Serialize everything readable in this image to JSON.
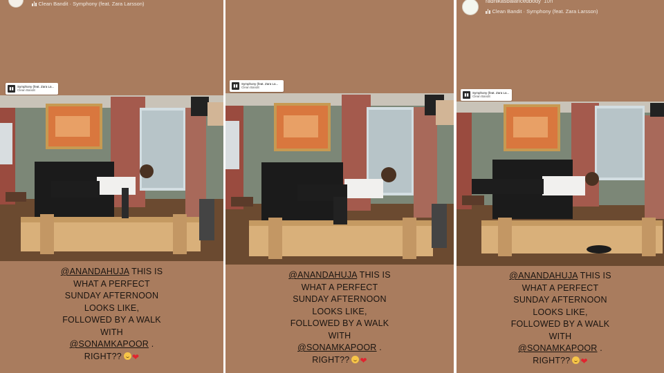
{
  "panels": [
    {
      "username": "",
      "post_time": "",
      "music_line": "Clean Bandit · Symphony (feat. Zara Larsson)",
      "sticker": {
        "song": "Symphony (feat. Zara La...",
        "artist": "Clean Bandit"
      },
      "caption": {
        "mention1": "@ANANDAHUJA",
        "line1_rest": " THIS IS",
        "line2": "WHAT A PERFECT",
        "line3": "SUNDAY AFTERNOON",
        "line4": "LOOKS LIKE,",
        "line5": "FOLLOWED BY A WALK",
        "line6": "WITH",
        "mention2": "@SONAMKAPOOR",
        "line7_rest": " .",
        "line8": "RIGHT??"
      }
    },
    {
      "username": "",
      "post_time": "",
      "music_line": "",
      "sticker": {
        "song": "Symphony (feat. Zara La...",
        "artist": "Clean Bandit"
      },
      "caption": {
        "mention1": "@ANANDAHUJA",
        "line1_rest": " THIS IS",
        "line2": "WHAT A PERFECT",
        "line3": "SUNDAY AFTERNOON",
        "line4": "LOOKS LIKE,",
        "line5": "FOLLOWED BY A WALK",
        "line6": "WITH",
        "mention2": "@SONAMKAPOOR",
        "line7_rest": " .",
        "line8": "RIGHT??"
      }
    },
    {
      "username": "radhikasbalancedbody",
      "post_time": "10h",
      "music_line": "Clean Bandit · Symphony (feat. Zara Larsson)",
      "sticker": {
        "song": "Symphony (feat. Zara La...",
        "artist": "Clean Bandit"
      },
      "caption": {
        "mention1": "@ANANDAHUJA",
        "line1_rest": " THIS IS",
        "line2": "WHAT A PERFECT",
        "line3": "SUNDAY AFTERNOON",
        "line4": "LOOKS LIKE,",
        "line5": "FOLLOWED BY A WALK",
        "line6": "WITH",
        "mention2": "@SONAMKAPOOR",
        "line7_rest": " .",
        "line8": "RIGHT??"
      }
    }
  ],
  "icons": [
    "music-bars-icon",
    "music-sticker-icon",
    "smiling-face-emoji",
    "red-heart-emoji"
  ],
  "colors": {
    "panel_bg": "#a97c5e",
    "caption_text": "#1a1410",
    "heart": "#e0242f"
  }
}
